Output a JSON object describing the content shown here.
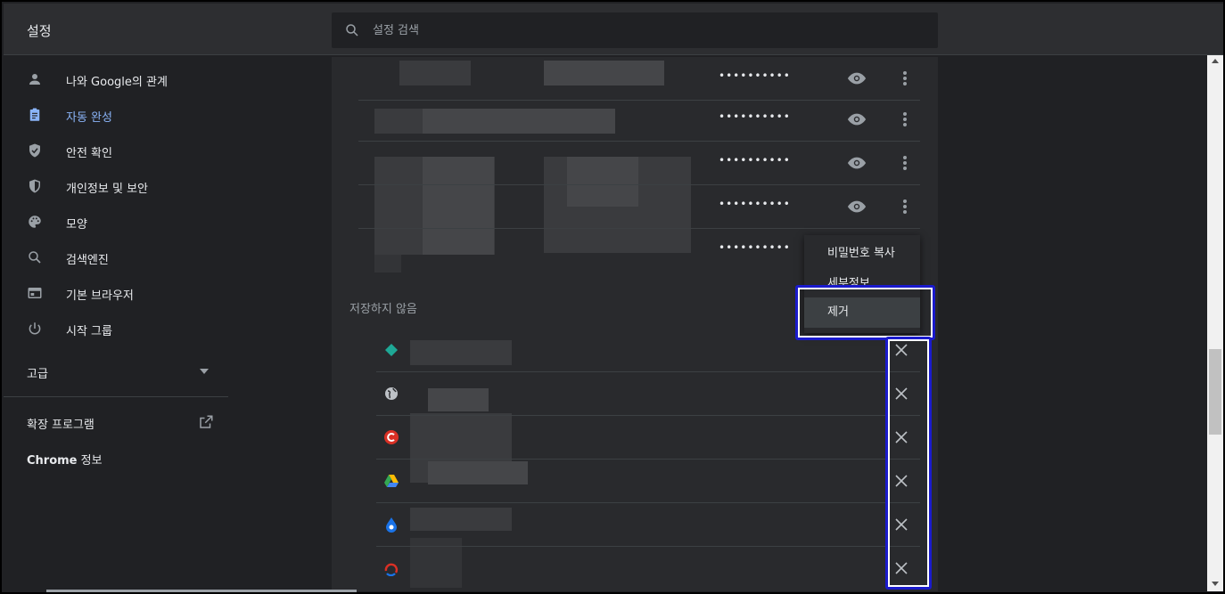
{
  "header": {
    "title": "설정",
    "search_placeholder": "설정 검색"
  },
  "sidebar": {
    "items": [
      {
        "label": "나와 Google의 관계",
        "icon": "person-icon"
      },
      {
        "label": "자동 완성",
        "icon": "clipboard-icon",
        "active": true
      },
      {
        "label": "안전 확인",
        "icon": "shield-check-icon"
      },
      {
        "label": "개인정보 및 보안",
        "icon": "shield-icon"
      },
      {
        "label": "모양",
        "icon": "palette-icon"
      },
      {
        "label": "검색엔진",
        "icon": "search-icon"
      },
      {
        "label": "기본 브라우저",
        "icon": "browser-icon"
      },
      {
        "label": "시작 그룹",
        "icon": "power-icon"
      }
    ],
    "advanced": "고급",
    "extensions": "확장 프로그램",
    "about_brand": "Chrome",
    "about_rest": " 정보"
  },
  "passwords": {
    "masked": "••••••••••",
    "rows": 5
  },
  "never_saved": {
    "title": "저장하지 않음",
    "sites": [
      {
        "favicon": "diamond-favicon",
        "color": "#1ea896"
      },
      {
        "favicon": "globe-favicon",
        "color": "#bdc1c6"
      },
      {
        "favicon": "c-favicon",
        "color": "#d93025"
      },
      {
        "favicon": "drive-favicon",
        "color": "#34a853"
      },
      {
        "favicon": "drop-favicon",
        "color": "#1a73e8"
      },
      {
        "favicon": "arc-favicon",
        "color": "#d93025"
      }
    ]
  },
  "context_menu": {
    "copy": "비밀번호 복사",
    "details": "세부정보",
    "remove": "제거"
  },
  "colors": {
    "accent": "#8ab4f8",
    "highlight_border": "#1a1acc"
  }
}
